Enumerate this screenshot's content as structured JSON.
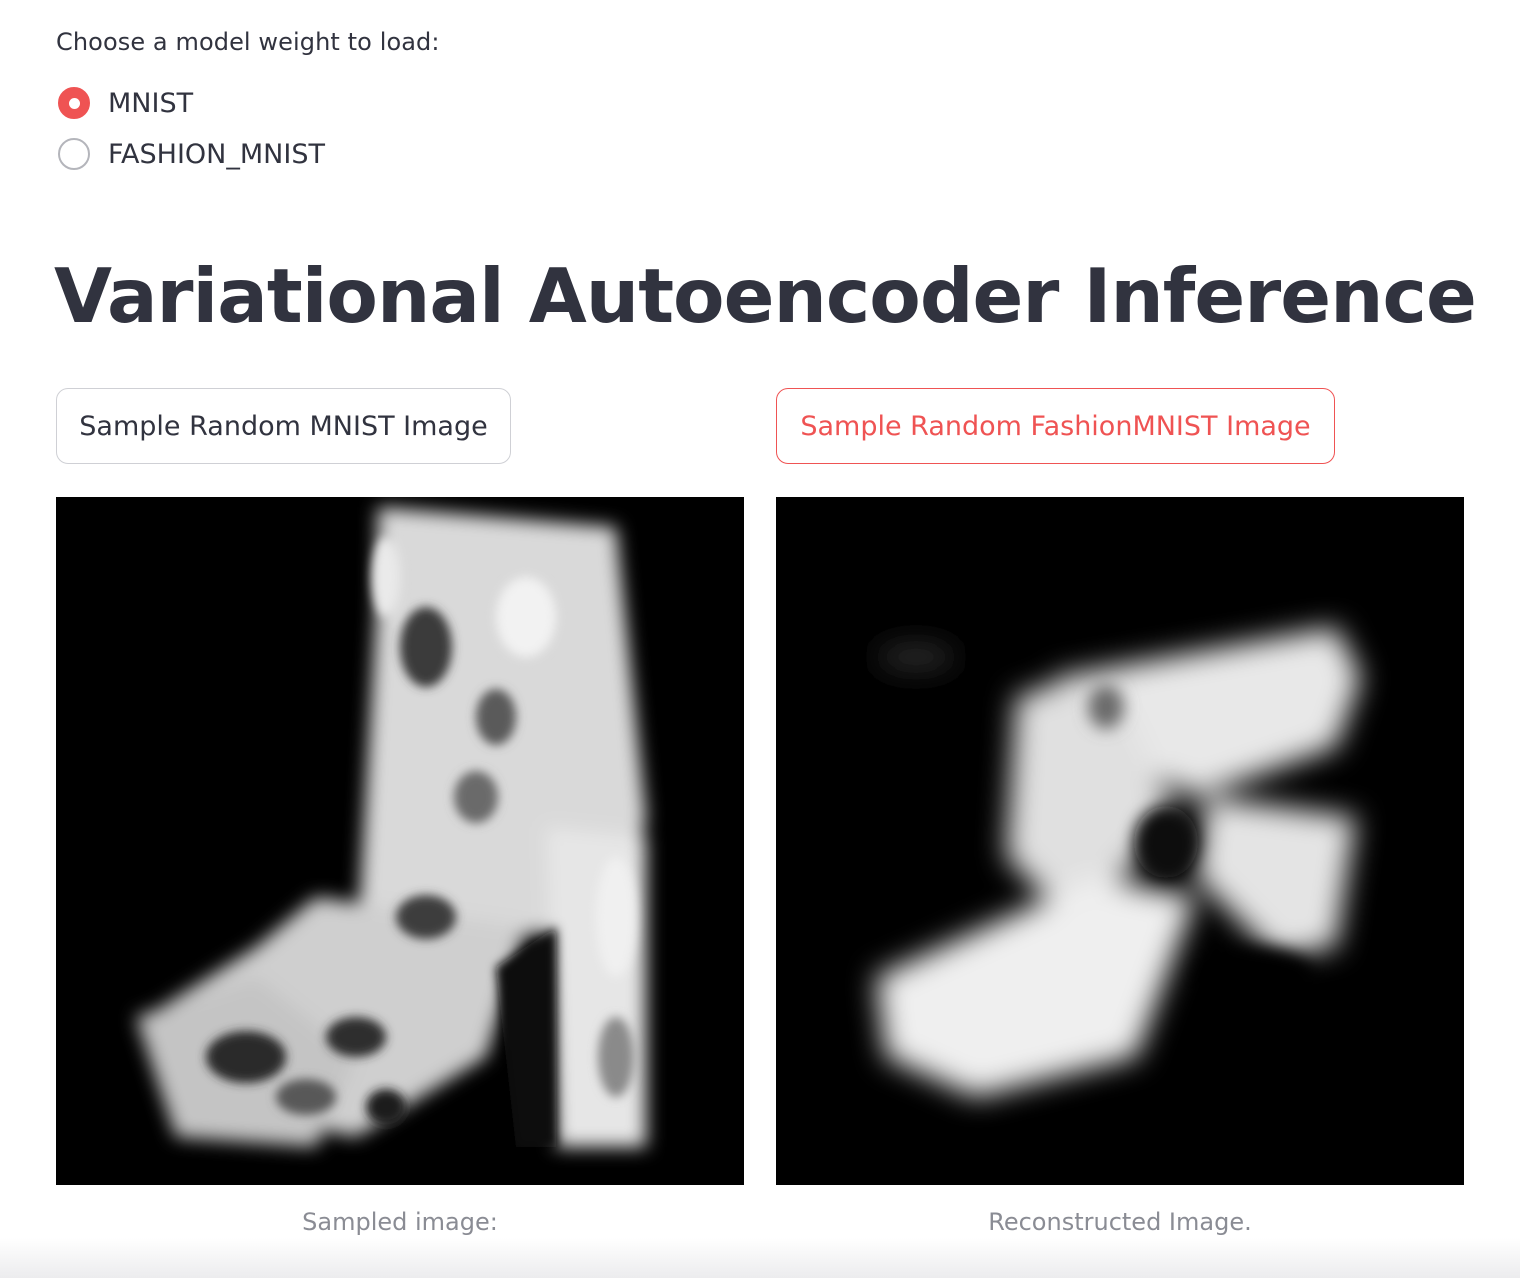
{
  "model_selector": {
    "label": "Choose a model weight to load:",
    "options": [
      {
        "label": "MNIST",
        "selected": true
      },
      {
        "label": "FASHION_MNIST",
        "selected": false
      }
    ]
  },
  "page": {
    "title": "Variational Autoencoder Inference"
  },
  "buttons": {
    "sample_mnist": "Sample Random MNIST Image",
    "sample_fashion": "Sample Random FashionMNIST Image"
  },
  "images": {
    "sampled_caption": "Sampled image:",
    "reconstructed_caption": "Reconstructed Image."
  },
  "colors": {
    "accent": "#ef5353",
    "text": "#31333f",
    "caption": "#8a8c94"
  }
}
